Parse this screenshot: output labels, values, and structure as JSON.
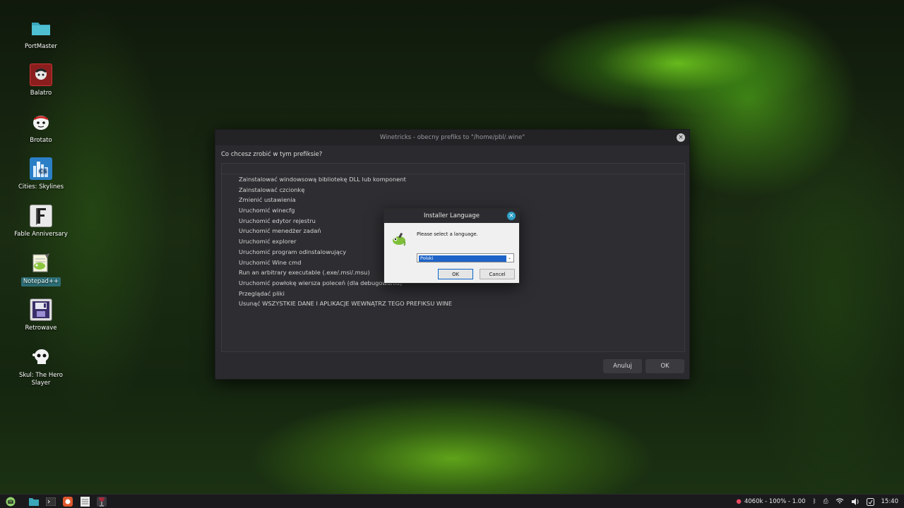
{
  "desktop": {
    "icons": [
      {
        "label": "PortMaster",
        "icon": "folder-icon"
      },
      {
        "label": "Balatro",
        "icon": "balatro-icon"
      },
      {
        "label": "Brotato",
        "icon": "brotato-icon"
      },
      {
        "label": "Cities: Skylines",
        "icon": "cities-skylines-icon"
      },
      {
        "label": "Fable Anniversary",
        "icon": "fable-icon"
      },
      {
        "label": "Notepad++",
        "icon": "notepadpp-icon"
      },
      {
        "label": "Retrowave",
        "icon": "retrowave-icon"
      },
      {
        "label": "Skul: The Hero Slayer",
        "icon": "skul-icon"
      }
    ]
  },
  "winetricks": {
    "title": "Winetricks - obecny prefiks to \"/home/pbl/.wine\"",
    "question": "Co chcesz zrobić w tym prefiksie?",
    "options": [
      "Zainstalować windowsową bibliotekę DLL lub komponent",
      "Zainstalować czcionkę",
      "Zmienić ustawienia",
      "Uruchomić winecfg",
      "Uruchomić edytor rejestru",
      "Uruchomić menedżer zadań",
      "Uruchomić explorer",
      "Uruchomić program odinstalowujący",
      "Uruchomić Wine cmd",
      "Run an arbitrary executable (.exe/.msi/.msu)",
      "Uruchomić powłokę wiersza poleceń (dla debugowania)",
      "Przeglądać pliki",
      "Usunąć WSZYSTKIE DANE I APLIKACJE WEWNĄTRZ TEGO PREFIKSU WINE"
    ],
    "cancel_label": "Anuluj",
    "ok_label": "OK"
  },
  "installer": {
    "title": "Installer Language",
    "message": "Please select a language.",
    "selected_language": "Polski",
    "ok_label": "OK",
    "cancel_label": "Cancel"
  },
  "taskbar": {
    "status": "4060k - 100% - 1.00",
    "clock": "15:40"
  },
  "colors": {
    "accent": "#2ea0c7",
    "selection": "#1e63c8",
    "window_bg": "#2b2b2f"
  }
}
